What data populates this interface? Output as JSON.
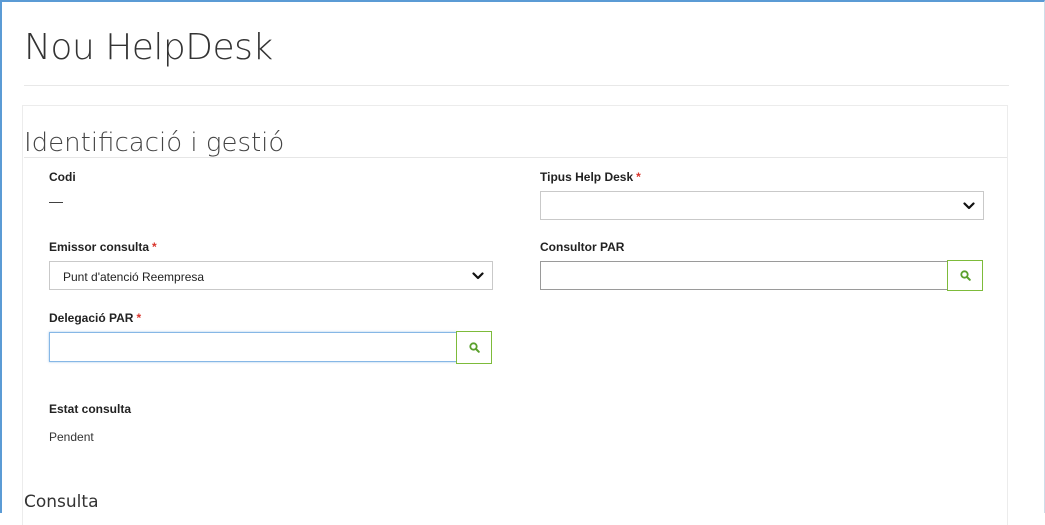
{
  "page": {
    "title": "Nou HelpDesk"
  },
  "section": {
    "title": "Identificació i gestió"
  },
  "fields": {
    "codi": {
      "label": "Codi",
      "value": "—"
    },
    "tipus_help_desk": {
      "label": "Tipus Help Desk",
      "required_mark": "*",
      "selected": ""
    },
    "emissor_consulta": {
      "label": "Emissor consulta",
      "required_mark": "*",
      "selected": "Punt d'atenció Reempresa"
    },
    "consultor_par": {
      "label": "Consultor PAR",
      "value": ""
    },
    "delegacio_par": {
      "label": "Delegació PAR",
      "required_mark": "*",
      "value": ""
    },
    "estat_consulta": {
      "label": "Estat consulta",
      "value": "Pendent"
    }
  },
  "next_section": {
    "title": "Consulta"
  },
  "icons": {
    "search": "search-icon",
    "dropdown": "chevron-down-icon"
  },
  "colors": {
    "required": "#d9342b",
    "search_border": "#7dbb3a",
    "search_icon": "#5aa02c",
    "focus_border": "#86b7e6"
  }
}
